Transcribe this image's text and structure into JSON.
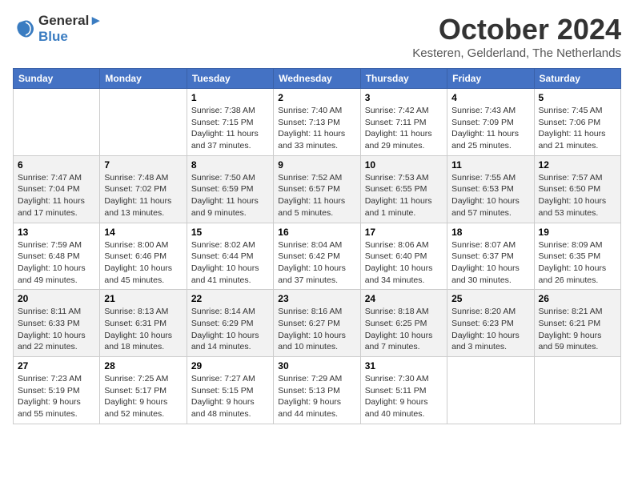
{
  "header": {
    "logo_line1": "General",
    "logo_line2": "Blue",
    "month_title": "October 2024",
    "subtitle": "Kesteren, Gelderland, The Netherlands"
  },
  "days_of_week": [
    "Sunday",
    "Monday",
    "Tuesday",
    "Wednesday",
    "Thursday",
    "Friday",
    "Saturday"
  ],
  "weeks": [
    [
      {
        "day": "",
        "info": ""
      },
      {
        "day": "",
        "info": ""
      },
      {
        "day": "1",
        "info": "Sunrise: 7:38 AM\nSunset: 7:15 PM\nDaylight: 11 hours and 37 minutes."
      },
      {
        "day": "2",
        "info": "Sunrise: 7:40 AM\nSunset: 7:13 PM\nDaylight: 11 hours and 33 minutes."
      },
      {
        "day": "3",
        "info": "Sunrise: 7:42 AM\nSunset: 7:11 PM\nDaylight: 11 hours and 29 minutes."
      },
      {
        "day": "4",
        "info": "Sunrise: 7:43 AM\nSunset: 7:09 PM\nDaylight: 11 hours and 25 minutes."
      },
      {
        "day": "5",
        "info": "Sunrise: 7:45 AM\nSunset: 7:06 PM\nDaylight: 11 hours and 21 minutes."
      }
    ],
    [
      {
        "day": "6",
        "info": "Sunrise: 7:47 AM\nSunset: 7:04 PM\nDaylight: 11 hours and 17 minutes."
      },
      {
        "day": "7",
        "info": "Sunrise: 7:48 AM\nSunset: 7:02 PM\nDaylight: 11 hours and 13 minutes."
      },
      {
        "day": "8",
        "info": "Sunrise: 7:50 AM\nSunset: 6:59 PM\nDaylight: 11 hours and 9 minutes."
      },
      {
        "day": "9",
        "info": "Sunrise: 7:52 AM\nSunset: 6:57 PM\nDaylight: 11 hours and 5 minutes."
      },
      {
        "day": "10",
        "info": "Sunrise: 7:53 AM\nSunset: 6:55 PM\nDaylight: 11 hours and 1 minute."
      },
      {
        "day": "11",
        "info": "Sunrise: 7:55 AM\nSunset: 6:53 PM\nDaylight: 10 hours and 57 minutes."
      },
      {
        "day": "12",
        "info": "Sunrise: 7:57 AM\nSunset: 6:50 PM\nDaylight: 10 hours and 53 minutes."
      }
    ],
    [
      {
        "day": "13",
        "info": "Sunrise: 7:59 AM\nSunset: 6:48 PM\nDaylight: 10 hours and 49 minutes."
      },
      {
        "day": "14",
        "info": "Sunrise: 8:00 AM\nSunset: 6:46 PM\nDaylight: 10 hours and 45 minutes."
      },
      {
        "day": "15",
        "info": "Sunrise: 8:02 AM\nSunset: 6:44 PM\nDaylight: 10 hours and 41 minutes."
      },
      {
        "day": "16",
        "info": "Sunrise: 8:04 AM\nSunset: 6:42 PM\nDaylight: 10 hours and 37 minutes."
      },
      {
        "day": "17",
        "info": "Sunrise: 8:06 AM\nSunset: 6:40 PM\nDaylight: 10 hours and 34 minutes."
      },
      {
        "day": "18",
        "info": "Sunrise: 8:07 AM\nSunset: 6:37 PM\nDaylight: 10 hours and 30 minutes."
      },
      {
        "day": "19",
        "info": "Sunrise: 8:09 AM\nSunset: 6:35 PM\nDaylight: 10 hours and 26 minutes."
      }
    ],
    [
      {
        "day": "20",
        "info": "Sunrise: 8:11 AM\nSunset: 6:33 PM\nDaylight: 10 hours and 22 minutes."
      },
      {
        "day": "21",
        "info": "Sunrise: 8:13 AM\nSunset: 6:31 PM\nDaylight: 10 hours and 18 minutes."
      },
      {
        "day": "22",
        "info": "Sunrise: 8:14 AM\nSunset: 6:29 PM\nDaylight: 10 hours and 14 minutes."
      },
      {
        "day": "23",
        "info": "Sunrise: 8:16 AM\nSunset: 6:27 PM\nDaylight: 10 hours and 10 minutes."
      },
      {
        "day": "24",
        "info": "Sunrise: 8:18 AM\nSunset: 6:25 PM\nDaylight: 10 hours and 7 minutes."
      },
      {
        "day": "25",
        "info": "Sunrise: 8:20 AM\nSunset: 6:23 PM\nDaylight: 10 hours and 3 minutes."
      },
      {
        "day": "26",
        "info": "Sunrise: 8:21 AM\nSunset: 6:21 PM\nDaylight: 9 hours and 59 minutes."
      }
    ],
    [
      {
        "day": "27",
        "info": "Sunrise: 7:23 AM\nSunset: 5:19 PM\nDaylight: 9 hours and 55 minutes."
      },
      {
        "day": "28",
        "info": "Sunrise: 7:25 AM\nSunset: 5:17 PM\nDaylight: 9 hours and 52 minutes."
      },
      {
        "day": "29",
        "info": "Sunrise: 7:27 AM\nSunset: 5:15 PM\nDaylight: 9 hours and 48 minutes."
      },
      {
        "day": "30",
        "info": "Sunrise: 7:29 AM\nSunset: 5:13 PM\nDaylight: 9 hours and 44 minutes."
      },
      {
        "day": "31",
        "info": "Sunrise: 7:30 AM\nSunset: 5:11 PM\nDaylight: 9 hours and 40 minutes."
      },
      {
        "day": "",
        "info": ""
      },
      {
        "day": "",
        "info": ""
      }
    ]
  ]
}
